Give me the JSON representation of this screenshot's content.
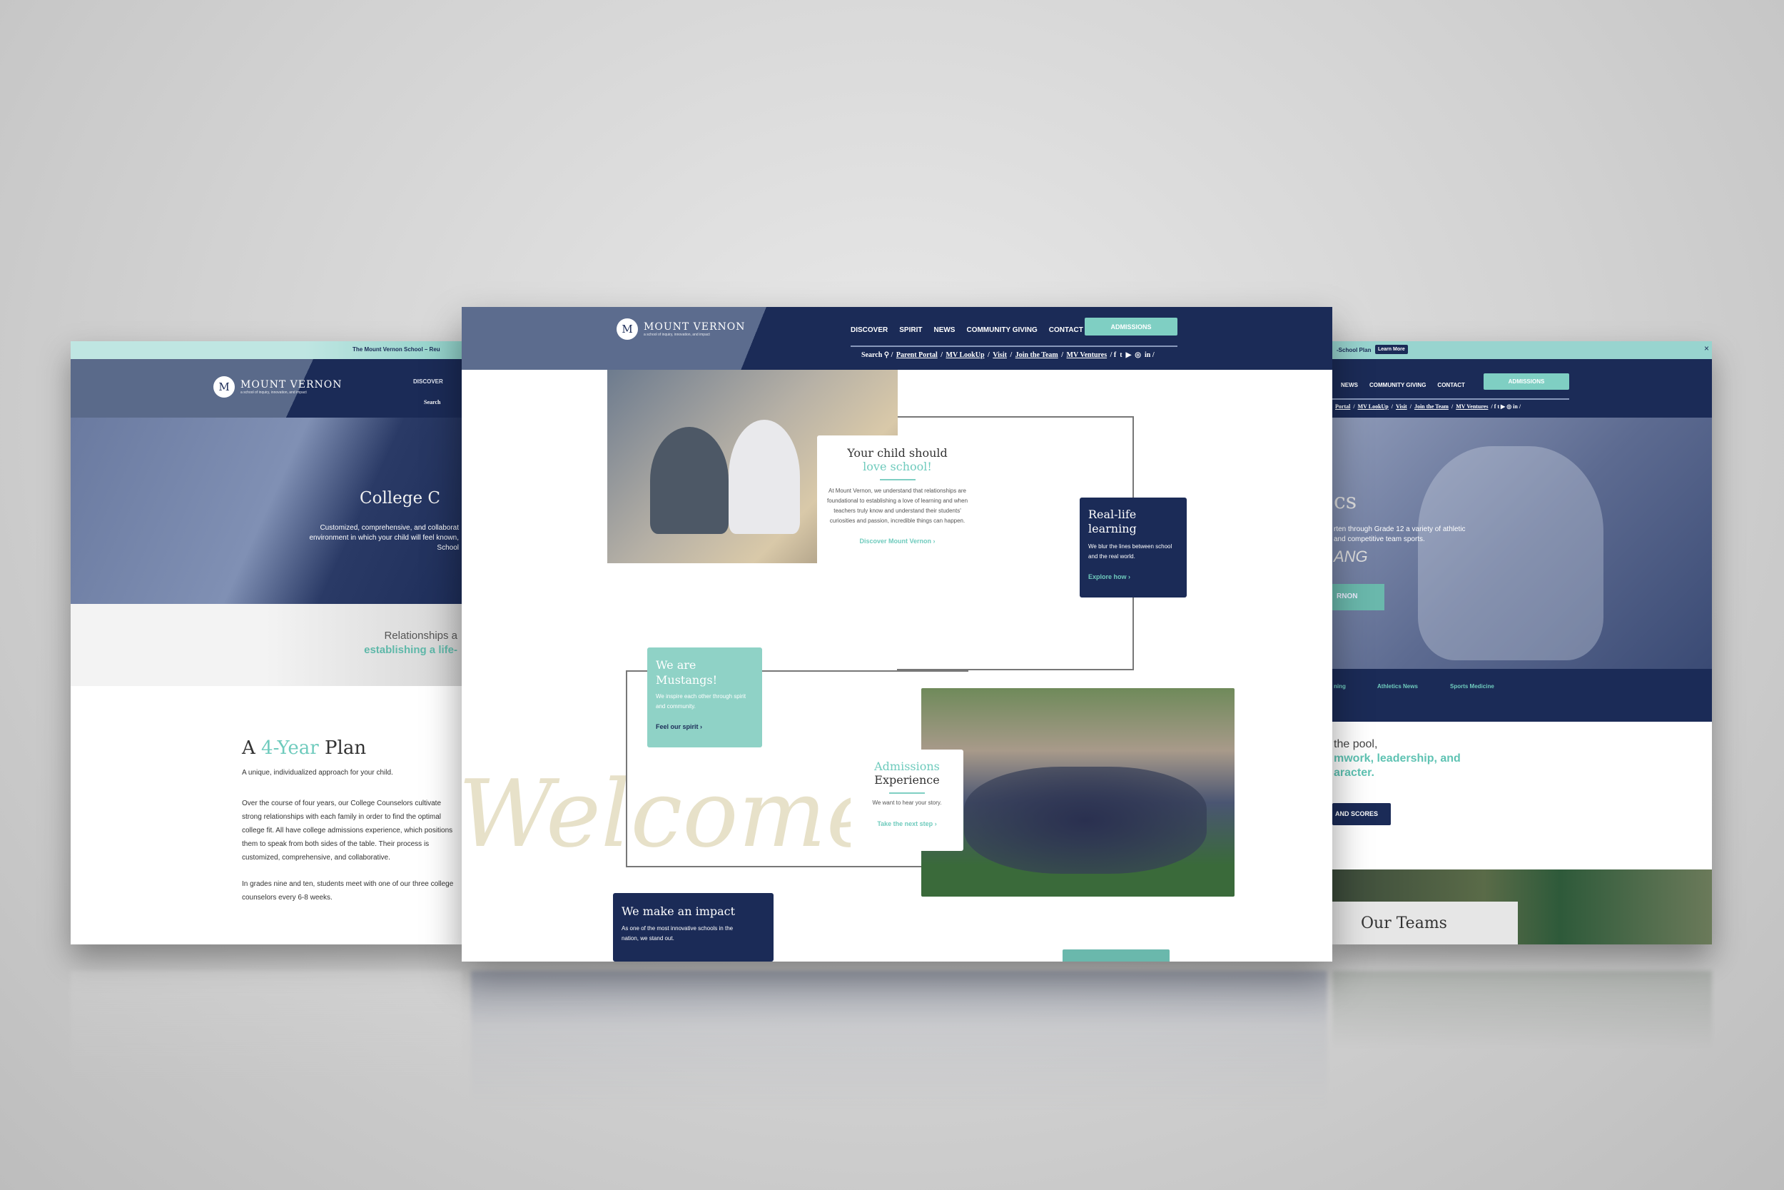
{
  "brand": {
    "name": "MOUNT VERNON",
    "tagline": "a school of inquiry, innovation, and impact",
    "monogram": "M"
  },
  "colors": {
    "navy": "#1b2b57",
    "teal": "#7fcfc3",
    "teal_text": "#5fc3b3",
    "background": "#d2d2d2"
  },
  "nav": {
    "items": [
      "DISCOVER",
      "SPIRIT",
      "NEWS",
      "COMMUNITY GIVING",
      "CONTACT"
    ],
    "cta": "ADMISSIONS"
  },
  "utility": {
    "search": "Search",
    "links": [
      "Parent Portal",
      "MV LookUp",
      "Visit",
      "Join the Team",
      "MV Ventures"
    ],
    "social_icons": [
      "facebook-icon",
      "twitter-icon",
      "youtube-icon",
      "instagram-icon",
      "linkedin-icon"
    ]
  },
  "left_page": {
    "banner": "The Mount Vernon School – Reu",
    "nav_partial": "DISCOVER",
    "search_partial": "Search",
    "hero_title": "College C",
    "hero_text": [
      "Customized, comprehensive, and collaborat",
      "environment in which your child will feel known,",
      "School"
    ],
    "band_line1": "Relationships a",
    "band_line2": "establishing a life-",
    "plan_title_a": "A ",
    "plan_title_b": "4-Year",
    "plan_title_c": " Plan",
    "plan_subtitle": "A unique, individualized approach for your child.",
    "plan_p1": "Over the course of four years, our College Counselors cultivate strong relationships with each family in order to find the optimal college fit. All have college admissions experience, which positions them to speak from both sides of the table. Their process is customized, comprehensive, and collaborative.",
    "plan_p2": "In grades nine and ten, students meet with one of our three college counselors every 6-8 weeks."
  },
  "center_page": {
    "love": {
      "line1": "Your child should",
      "line2": "love school!",
      "body": "At Mount Vernon, we understand that relationships are foundational to establishing a love of learning and when teachers truly know and understand their students' curiosities and passion, incredible things can happen.",
      "link": "Discover Mount Vernon"
    },
    "real_life": {
      "title": "Real-life learning",
      "body": "We blur the lines between school and the real world.",
      "link": "Explore how"
    },
    "mustangs": {
      "title": "We are Mustangs!",
      "body": "We inspire each other through spirit and community.",
      "link": "Feel our spirit"
    },
    "admissions": {
      "line1": "Admissions",
      "line2": "Experience",
      "body": "We want to hear your story.",
      "link": "Take the next step"
    },
    "impact": {
      "title": "We make an impact",
      "body": "As one of the most innovative schools in the nation, we stand out."
    },
    "watermark": "Welcome"
  },
  "right_page": {
    "banner": "-School Plan",
    "banner_button": "Learn More",
    "nav_partial": [
      "NEWS",
      "COMMUNITY GIVING",
      "CONTACT"
    ],
    "util_partial": [
      "Portal",
      "MV LookUp",
      "Visit",
      "Join the Team",
      "MV Ventures"
    ],
    "hero_title": "cs",
    "hero_text": [
      "rten through Grade 12 a variety of athletic",
      "and competitive team sports."
    ],
    "hero_script": "ANG",
    "hero_button": "RNON",
    "subnav": [
      "ning",
      "Athletics News",
      "Sports Medicine"
    ],
    "body_line1": "the pool,",
    "body_line2": "mwork, leadership, and",
    "body_line3": "aracter.",
    "scores_button": "AND SCORES",
    "teams_title": "Our Teams"
  }
}
